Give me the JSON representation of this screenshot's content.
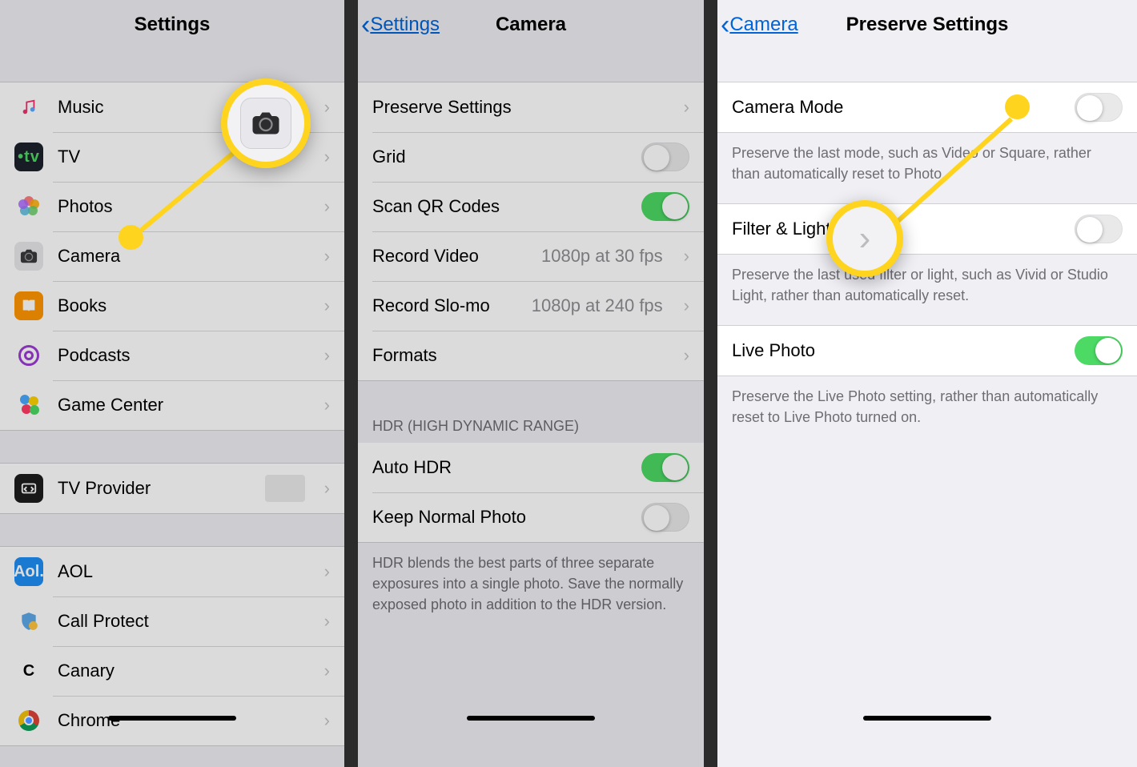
{
  "panels": {
    "settings": {
      "title": "Settings",
      "items_a": [
        {
          "label": "Music"
        },
        {
          "label": "TV"
        },
        {
          "label": "Photos"
        },
        {
          "label": "Camera"
        },
        {
          "label": "Books"
        },
        {
          "label": "Podcasts"
        },
        {
          "label": "Game Center"
        }
      ],
      "item_tvprov": {
        "label": "TV Provider"
      },
      "items_b": [
        {
          "label": "AOL"
        },
        {
          "label": "Call Protect"
        },
        {
          "label": "Canary"
        },
        {
          "label": "Chrome"
        }
      ]
    },
    "camera": {
      "back": "Settings",
      "title": "Camera",
      "rows": {
        "preserve": {
          "label": "Preserve Settings"
        },
        "grid": {
          "label": "Grid",
          "on": false
        },
        "qr": {
          "label": "Scan QR Codes",
          "on": true
        },
        "record": {
          "label": "Record Video",
          "value": "1080p at 30 fps"
        },
        "slomo": {
          "label": "Record Slo-mo",
          "value": "1080p at 240 fps"
        },
        "formats": {
          "label": "Formats"
        }
      },
      "hdr_header": "HDR (HIGH DYNAMIC RANGE)",
      "hdr": {
        "auto": {
          "label": "Auto HDR",
          "on": true
        },
        "keep": {
          "label": "Keep Normal Photo",
          "on": false
        }
      },
      "hdr_footer": "HDR blends the best parts of three separate exposures into a single photo. Save the normally exposed photo in addition to the HDR version."
    },
    "preserve": {
      "back": "Camera",
      "title": "Preserve Settings",
      "rows": {
        "mode": {
          "label": "Camera Mode",
          "on": false,
          "footer": "Preserve the last mode, such as Video or Square, rather than automatically reset to Photo."
        },
        "filter": {
          "label": "Filter & Lighting",
          "on": false,
          "footer": "Preserve the last used filter or light, such as Vivid or Studio Light, rather than automatically reset."
        },
        "live": {
          "label": "Live Photo",
          "on": true,
          "footer": "Preserve the Live Photo setting, rather than automatically reset to Live Photo turned on."
        }
      }
    }
  }
}
